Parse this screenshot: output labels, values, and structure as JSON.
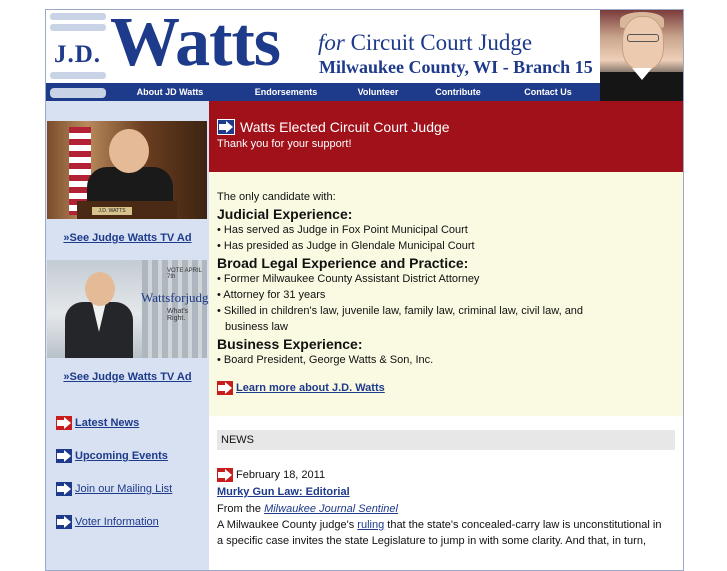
{
  "header": {
    "jd": "J.D.",
    "name": "Watts",
    "tagline_for": "for",
    "tagline_rest": "Circuit Court Judge",
    "subline": "Milwaukee County, WI - Branch 15"
  },
  "nav": {
    "items": [
      "About JD Watts",
      "Endorsements",
      "Volunteer",
      "Contribute",
      "Contact Us"
    ]
  },
  "sidebar": {
    "tv_ad_1": "»See Judge Watts TV Ad",
    "tv_ad_2": "»See Judge Watts TV Ad",
    "thumb2_watermark": "Wattsforjudge.com",
    "thumb2_tagline": "What's Right.",
    "thumb2_vote": "VOTE APRIL 7th",
    "thumb1_plate": "J.D. WATTS",
    "links": [
      "Latest News",
      "Upcoming Events",
      "Join our Mailing List",
      "Voter Information"
    ]
  },
  "banner": {
    "title": "Watts Elected Circuit Court Judge",
    "subtitle": "Thank you for your support!"
  },
  "credentials": {
    "intro": "The only candidate with:",
    "judicial_heading": "Judicial Experience:",
    "judicial_1": "• Has served as Judge in Fox Point Municipal Court",
    "judicial_2": "• Has presided as Judge in Glendale Municipal Court",
    "legal_heading": "Broad Legal Experience and Practice:",
    "legal_1": "• Former Milwaukee County Assistant District Attorney",
    "legal_2": "• Attorney for 31 years",
    "legal_3a": "• Skilled in children's law, juvenile law, family law, criminal law, civil law, and",
    "legal_3b": "business law",
    "business_heading": "Business Experience:",
    "business_1": "• Board President, George Watts & Son, Inc.",
    "learn_more": "Learn more about J.D. Watts"
  },
  "news": {
    "heading": "NEWS",
    "date": "February 18, 2011",
    "headline": "Murky Gun Law: Editorial",
    "from_label": "From the",
    "source": "Milwaukee Journal Sentinel",
    "body_1_pre": "A Milwaukee County judge's",
    "body_1_link": "ruling",
    "body_1_post": "that the state's concealed-carry law is unconstitutional in",
    "body_2": "a specific case invites the state Legislature to jump in with some clarity. And that, in turn,"
  },
  "colors": {
    "brand_blue": "#1e3a8a",
    "banner_red": "#a0111a",
    "sidebar_bg": "#d7e1f2",
    "creds_bg": "#fafae3",
    "arrow_red": "#c81d1d"
  }
}
